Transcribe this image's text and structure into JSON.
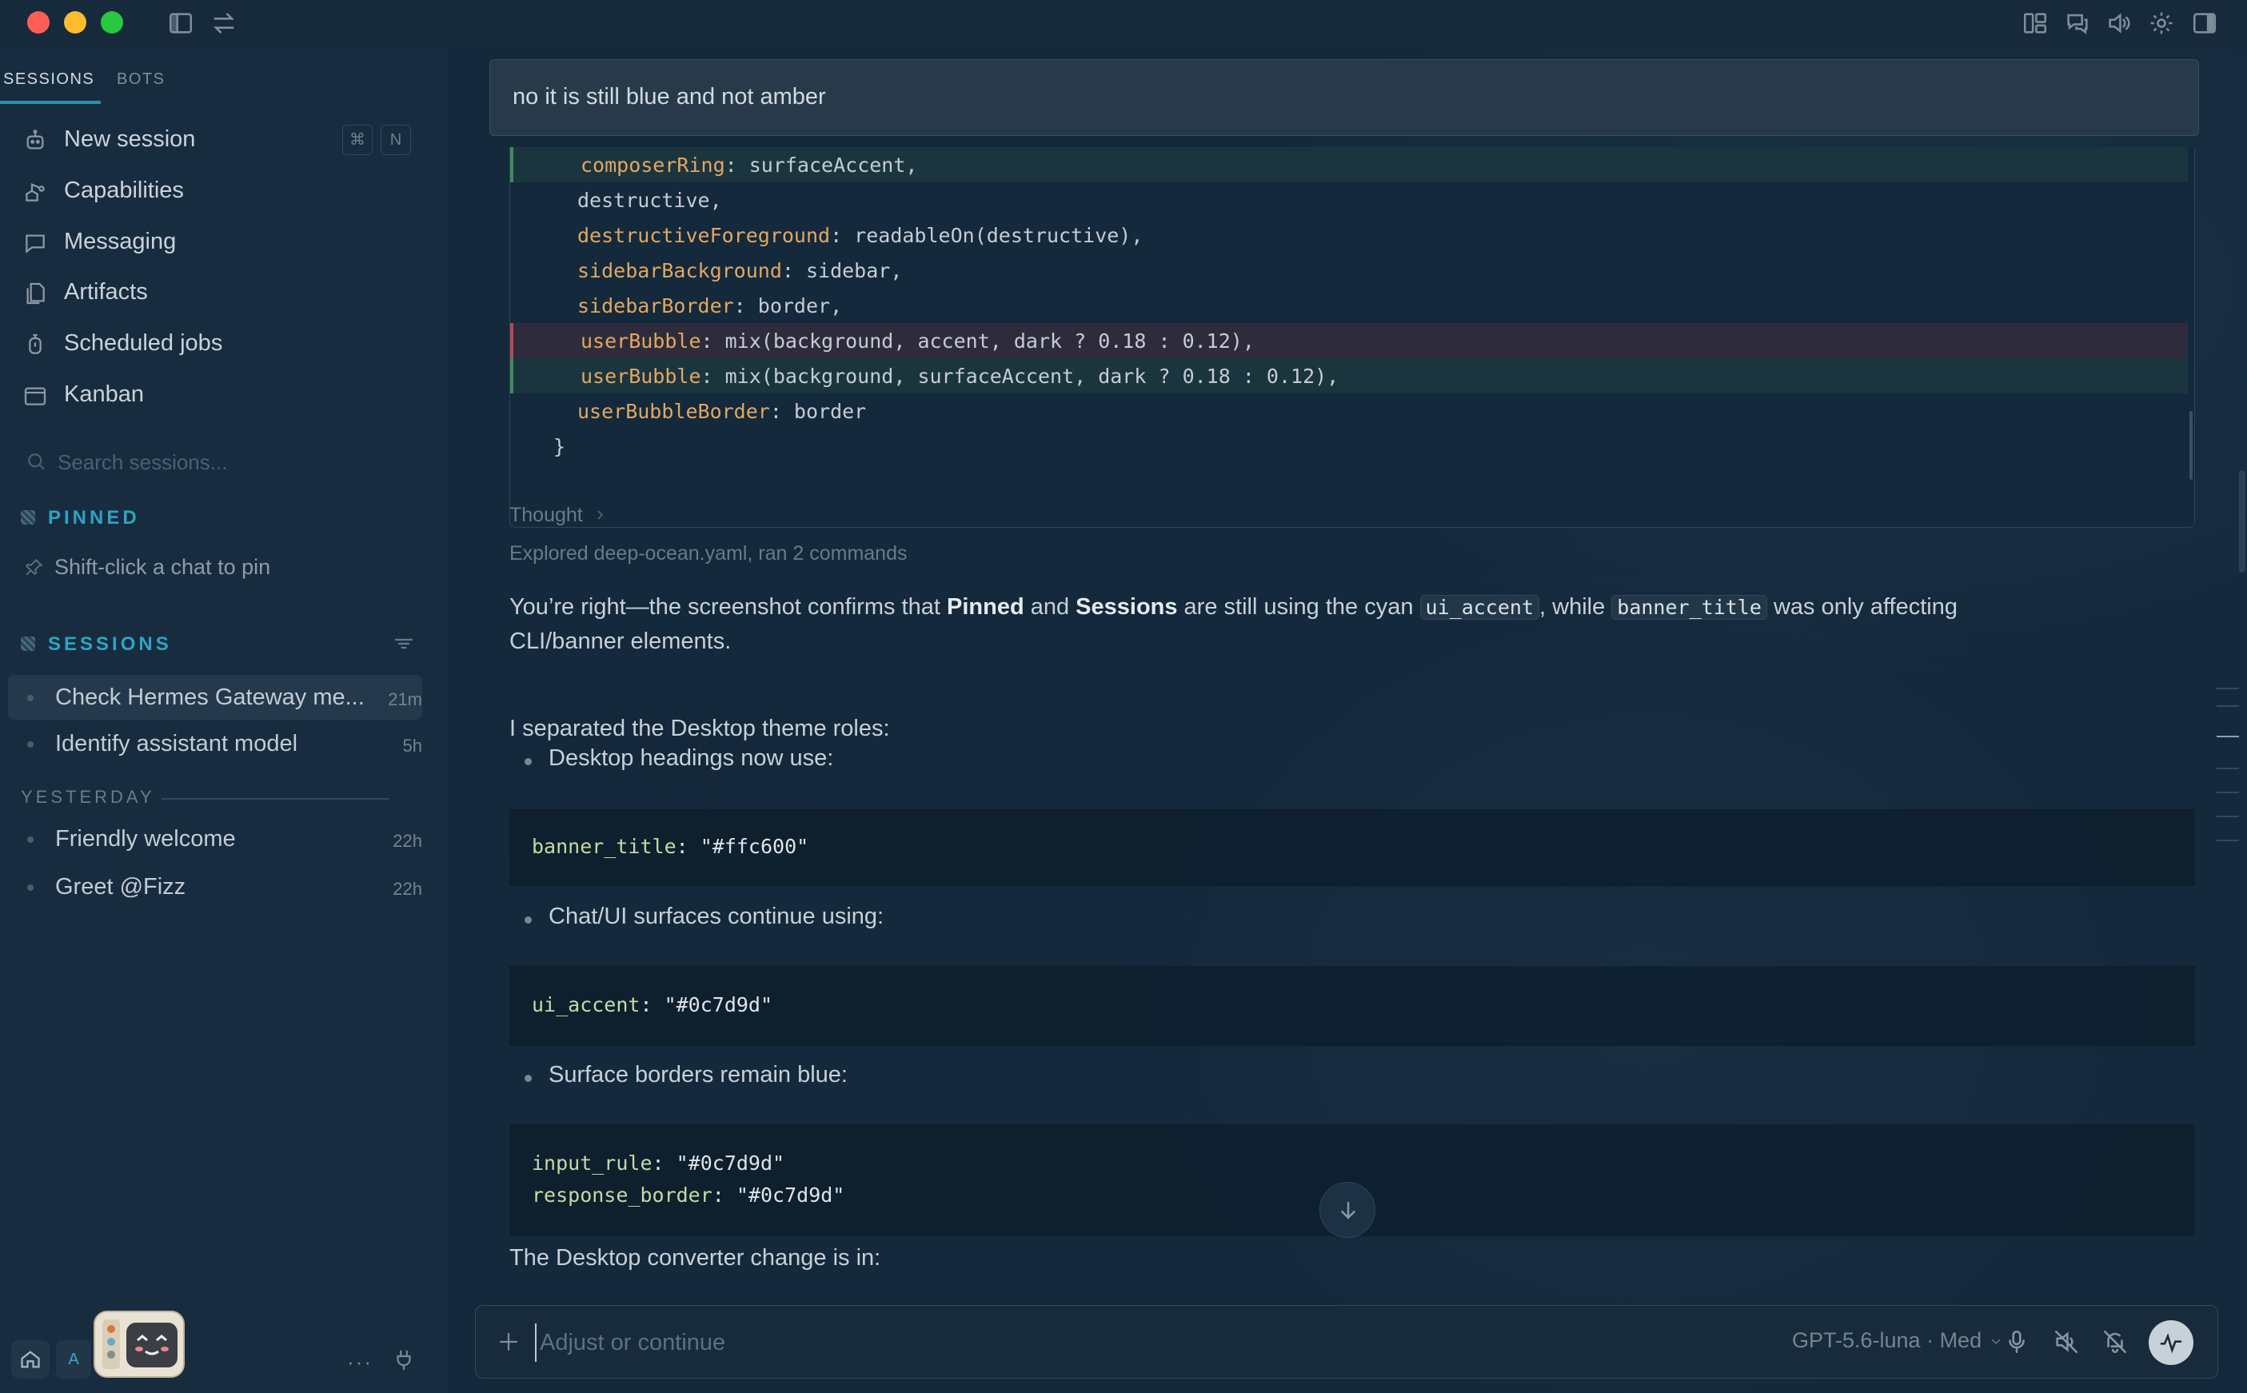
{
  "sidebar": {
    "tabs": [
      {
        "label": "SESSIONS",
        "active": true
      },
      {
        "label": "BOTS",
        "active": false
      }
    ],
    "nav": [
      {
        "label": "New session",
        "icon": "robot-icon",
        "shortcut": [
          "⌘",
          "N"
        ]
      },
      {
        "label": "Capabilities",
        "icon": "capabilities-icon"
      },
      {
        "label": "Messaging",
        "icon": "chat-bubble-icon"
      },
      {
        "label": "Artifacts",
        "icon": "documents-icon"
      },
      {
        "label": "Scheduled jobs",
        "icon": "hourglass-icon"
      },
      {
        "label": "Kanban",
        "icon": "kanban-icon"
      }
    ],
    "search": {
      "placeholder": "Search sessions..."
    },
    "pinned": {
      "title": "PINNED",
      "hint": "Shift-click a chat to pin"
    },
    "sessions": {
      "title": "SESSIONS",
      "items": [
        {
          "label": "Check Hermes Gateway me...",
          "time": "21m",
          "active": true
        },
        {
          "label": "Identify assistant model",
          "time": "5h",
          "active": false
        }
      ],
      "yesterday_label": "YESTERDAY",
      "yesterday": [
        {
          "label": "Friendly welcome",
          "time": "22h"
        },
        {
          "label": "Greet @Fizz",
          "time": "22h"
        }
      ]
    },
    "bottom": {
      "avatar_letter": "A",
      "more": "···"
    }
  },
  "chat": {
    "user_message": "no it is still blue and not amber",
    "code_lines": [
      {
        "kind": "add",
        "key": "composerRing",
        "rest": ": surfaceAccent,"
      },
      {
        "kind": "ctx",
        "key": "",
        "rest": "destructive,"
      },
      {
        "kind": "ctx",
        "key": "destructiveForeground",
        "rest": ": readableOn(destructive),"
      },
      {
        "kind": "ctx",
        "key": "sidebarBackground",
        "rest": ": sidebar,"
      },
      {
        "kind": "ctx",
        "key": "sidebarBorder",
        "rest": ": border,"
      },
      {
        "kind": "del",
        "key": "userBubble",
        "rest": ": mix(background, accent, dark ? 0.18 : 0.12),"
      },
      {
        "kind": "add",
        "key": "userBubble",
        "rest": ": mix(background, surfaceAccent, dark ? 0.18 : 0.12),"
      },
      {
        "kind": "ctx",
        "key": "userBubbleBorder",
        "rest": ": border"
      },
      {
        "kind": "ctx",
        "key": "",
        "rest": "}"
      }
    ],
    "thought_label": "Thought",
    "explored": "Explored deep-ocean.yaml, ran 2 commands",
    "reply": {
      "p1_a": "You’re right—the screenshot confirms that ",
      "p1_b1": "Pinned",
      "p1_and": " and ",
      "p1_b2": "Sessions",
      "p1_c": " are still using the cyan ",
      "p1_code1": "ui_accent",
      "p1_d": ", while ",
      "p1_code2": "banner_title",
      "p1_e": " was only affecting",
      "p1_line2": "CLI/banner elements.",
      "p2": "I separated the Desktop theme roles:",
      "b1": "Desktop headings now use:",
      "y1_key": "banner_title",
      "y1_val": ": \"#ffc600\"",
      "b2": "Chat/UI surfaces continue using:",
      "y2_key": "ui_accent",
      "y2_val": ": \"#0c7d9d\"",
      "b3": "Surface borders remain blue:",
      "y3a_key": "input_rule",
      "y3a_val": ": \"#0c7d9d\"",
      "y3b_key": "response_border",
      "y3b_val": ": \"#0c7d9d\"",
      "p3": "The Desktop converter change is in:"
    }
  },
  "composer": {
    "placeholder": "Adjust or continue",
    "model": "GPT-5.6-luna · Med"
  },
  "colors": {
    "accent": "#2fa3c4",
    "background": "#14293b",
    "sidebar": "#182c3f"
  }
}
